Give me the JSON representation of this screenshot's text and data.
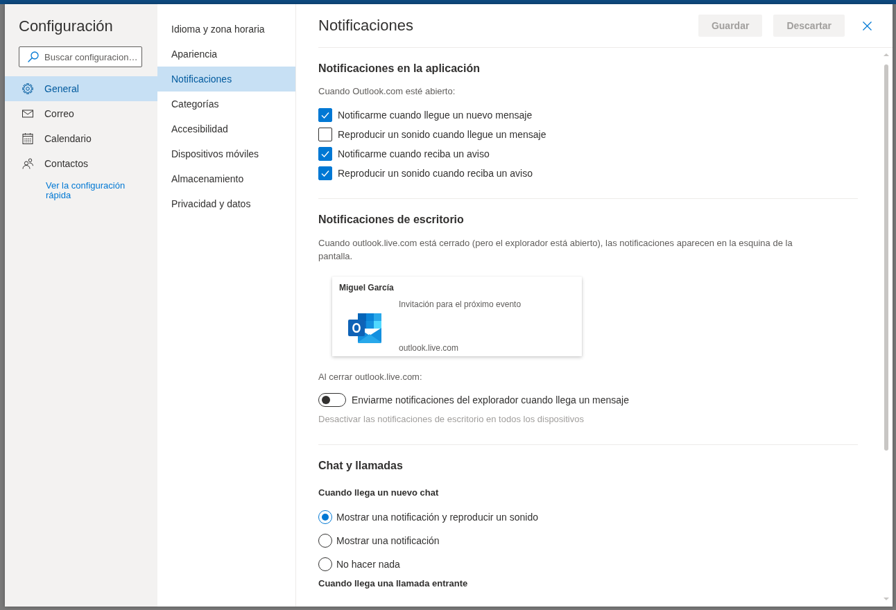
{
  "window": {
    "title": "Configuración"
  },
  "search": {
    "placeholder": "Buscar configuracion…"
  },
  "sidebar": {
    "items": [
      {
        "label": "General",
        "selected": true
      },
      {
        "label": "Correo",
        "selected": false
      },
      {
        "label": "Calendario",
        "selected": false
      },
      {
        "label": "Contactos",
        "selected": false
      }
    ],
    "link": "Ver la configuración rápida"
  },
  "categories": {
    "items": [
      {
        "label": "Idioma y zona horaria",
        "selected": false
      },
      {
        "label": "Apariencia",
        "selected": false
      },
      {
        "label": "Notificaciones",
        "selected": true
      },
      {
        "label": "Categorías",
        "selected": false
      },
      {
        "label": "Accesibilidad",
        "selected": false
      },
      {
        "label": "Dispositivos móviles",
        "selected": false
      },
      {
        "label": "Almacenamiento",
        "selected": false
      },
      {
        "label": "Privacidad y datos",
        "selected": false
      }
    ]
  },
  "panel": {
    "title": "Notificaciones",
    "buttons": [
      {
        "label": "Guardar",
        "disabled": true
      },
      {
        "label": "Descartar",
        "disabled": true
      }
    ]
  },
  "in_app": {
    "title": "Notificaciones en la aplicación",
    "intro": "Cuando Outlook.com esté abierto:",
    "checkboxes": [
      {
        "label": "Notificarme cuando llegue un nuevo mensaje",
        "checked": true
      },
      {
        "label": "Reproducir un sonido cuando llegue un mensaje",
        "checked": false
      },
      {
        "label": "Notificarme cuando reciba un aviso",
        "checked": true
      },
      {
        "label": "Reproducir un sonido cuando reciba un aviso",
        "checked": true
      }
    ]
  },
  "desktop": {
    "title": "Notificaciones de escritorio",
    "description": "Cuando outlook.live.com está cerrado (pero el explorador está abierto), las notificaciones aparecen en la esquina de la pantalla.",
    "preview": {
      "sender": "Miguel García",
      "message": "Invitación para el próximo evento",
      "source": "outlook.live.com"
    },
    "closed_label": "Al cerrar outlook.live.com:",
    "toggle": {
      "label": "Enviarme notificaciones del explorador cuando llega un mensaje",
      "on": false
    },
    "link": {
      "label": "Desactivar las notificaciones de escritorio en todos los dispositivos",
      "disabled": true
    }
  },
  "chat_calls": {
    "title": "Chat y llamadas",
    "groups": [
      {
        "heading": "Cuando llega un nuevo chat",
        "options": [
          {
            "label": "Mostrar una notificación y reproducir un sonido",
            "selected": true
          },
          {
            "label": "Mostrar una notificación",
            "selected": false
          },
          {
            "label": "No hacer nada",
            "selected": false
          }
        ]
      },
      {
        "heading": "Cuando llega una llamada entrante"
      }
    ]
  }
}
